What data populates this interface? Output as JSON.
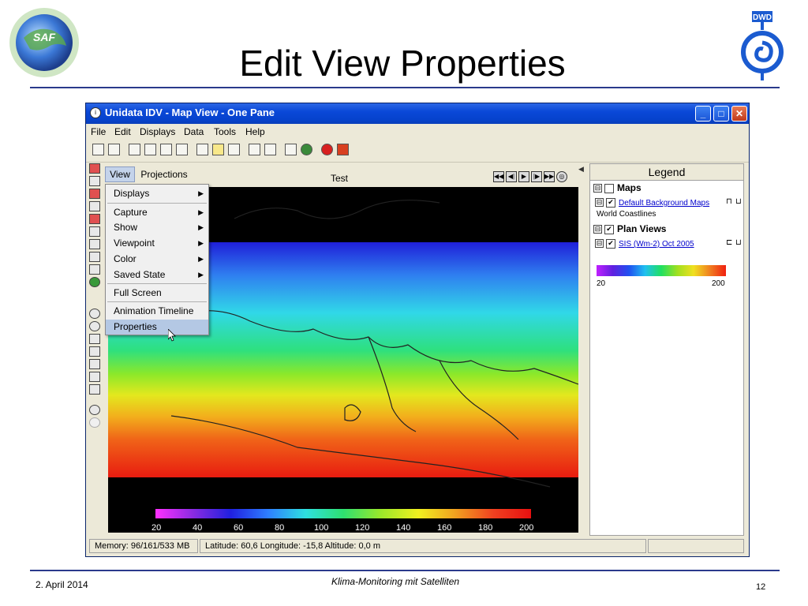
{
  "slide": {
    "title": "Edit View Properties",
    "logo_left_text": "THE SAF ON CLIMATE MONITORING",
    "logo_right_text": "DWD",
    "footer_date": "2. April 2014",
    "footer_center": "Klima-Monitoring mit Satelliten",
    "page_number": "12"
  },
  "window": {
    "title": "Unidata IDV - Map View - One Pane",
    "controls": {
      "minimize": "_",
      "maximize": "□",
      "close": "✕"
    },
    "menubar": [
      "File",
      "Edit",
      "Displays",
      "Data",
      "Tools",
      "Help"
    ]
  },
  "view_panel": {
    "tabs": [
      "View",
      "Projections"
    ],
    "map_label": "Test",
    "anim_buttons": [
      "◀◀",
      "◀|",
      "▶",
      "|▶",
      "▶▶",
      "◎"
    ],
    "colorbar_labels": [
      "20",
      "40",
      "60",
      "80",
      "100",
      "120",
      "140",
      "160",
      "180",
      "200"
    ]
  },
  "view_menu": {
    "items": [
      {
        "label": "Displays",
        "submenu": true
      },
      {
        "label": "Capture",
        "submenu": true
      },
      {
        "label": "Show",
        "submenu": true
      },
      {
        "label": "Viewpoint",
        "submenu": true
      },
      {
        "label": "Color",
        "submenu": true
      },
      {
        "label": "Saved State",
        "submenu": true
      },
      {
        "label": "Full Screen",
        "submenu": false
      },
      {
        "label": "Animation Timeline",
        "submenu": false
      },
      {
        "label": "Properties",
        "submenu": false
      }
    ],
    "arrow": "▶",
    "highlighted": "Properties"
  },
  "legend": {
    "header": "Legend",
    "collapse_glyph": "◀",
    "maps_group": "Maps",
    "maps_item_link": "Default Background Maps",
    "maps_item_sub": "World Coastlines",
    "plan_group": "Plan Views",
    "plan_item_link": "SIS (Wm-2) Oct 2005",
    "colorbar_min": "20",
    "colorbar_max": "200",
    "expand_glyph": "⊟",
    "check_glyph": "✔"
  },
  "statusbar": {
    "memory": "Memory: 96/161/533 MB",
    "position": "Latitude:   60,6 Longitude:  -15,8 Altitude:    0,0 m"
  }
}
